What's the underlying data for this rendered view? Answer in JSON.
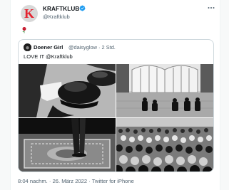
{
  "author": {
    "name": "KRAFTKLUB",
    "handle": "@Kraftklub",
    "avatar_letter": "K",
    "avatar_color": "#e4222e",
    "verified_icon": "verified-badge-icon"
  },
  "tweet": {
    "text_icon": "rose-icon"
  },
  "quote": {
    "name": "Doener Girl",
    "handle": "@daisyglow",
    "time": "2 Std.",
    "text": "LOVE IT @Kraftklub",
    "media": [
      {
        "kind": "photo",
        "subject": "shoes"
      },
      {
        "kind": "photo",
        "subject": "hall"
      },
      {
        "kind": "photo",
        "subject": "carpet"
      },
      {
        "kind": "photo",
        "subject": "crowd"
      }
    ]
  },
  "meta": {
    "timestamp": "8:04 nachm.",
    "date": "26. März 2022",
    "source": "Twitter for iPhone"
  },
  "colors": {
    "link": "#1d9bf0",
    "secondary_text": "#536471",
    "border": "#cfd9de"
  }
}
